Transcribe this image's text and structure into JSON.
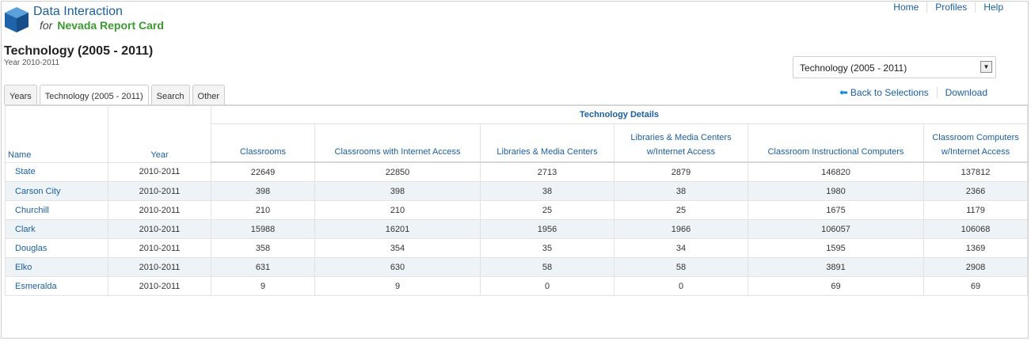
{
  "logo": {
    "line1": "Data Interaction",
    "for": "for",
    "line2": "Nevada Report Card"
  },
  "topnav": [
    "Home",
    "Profiles",
    "Help"
  ],
  "page": {
    "title": "Technology (2005 - 2011)",
    "subtitle": "Year 2010-2011"
  },
  "report_select": {
    "value": "Technology (2005 - 2011)"
  },
  "links": {
    "back": "Back to Selections",
    "download": "Download"
  },
  "tabs": [
    {
      "label": "Years",
      "active": false
    },
    {
      "label": "Technology (2005 - 2011)",
      "active": true
    },
    {
      "label": "Search",
      "active": false
    },
    {
      "label": "Other",
      "active": false
    }
  ],
  "table": {
    "group_header": "Technology Details",
    "columns": {
      "name": "Name",
      "year": "Year",
      "classrooms": "Classrooms",
      "classrooms_internet": "Classrooms with Internet Access",
      "libraries": "Libraries & Media Centers",
      "libraries_internet": "Libraries & Media Centers w/Internet Access",
      "instr_computers": "Classroom Instructional Computers",
      "computers_internet": "Classroom Computers w/Internet Access"
    },
    "rows": [
      {
        "name": "State",
        "year": "2010-2011",
        "c1": "22649",
        "c2": "22850",
        "c3": "2713",
        "c4": "2879",
        "c5": "146820",
        "c6": "137812"
      },
      {
        "name": "Carson City",
        "year": "2010-2011",
        "c1": "398",
        "c2": "398",
        "c3": "38",
        "c4": "38",
        "c5": "1980",
        "c6": "2366"
      },
      {
        "name": "Churchill",
        "year": "2010-2011",
        "c1": "210",
        "c2": "210",
        "c3": "25",
        "c4": "25",
        "c5": "1675",
        "c6": "1179"
      },
      {
        "name": "Clark",
        "year": "2010-2011",
        "c1": "15988",
        "c2": "16201",
        "c3": "1956",
        "c4": "1966",
        "c5": "106057",
        "c6": "106068"
      },
      {
        "name": "Douglas",
        "year": "2010-2011",
        "c1": "358",
        "c2": "354",
        "c3": "35",
        "c4": "34",
        "c5": "1595",
        "c6": "1369"
      },
      {
        "name": "Elko",
        "year": "2010-2011",
        "c1": "631",
        "c2": "630",
        "c3": "58",
        "c4": "58",
        "c5": "3891",
        "c6": "2908"
      },
      {
        "name": "Esmeralda",
        "year": "2010-2011",
        "c1": "9",
        "c2": "9",
        "c3": "0",
        "c4": "0",
        "c5": "69",
        "c6": "69"
      }
    ]
  }
}
